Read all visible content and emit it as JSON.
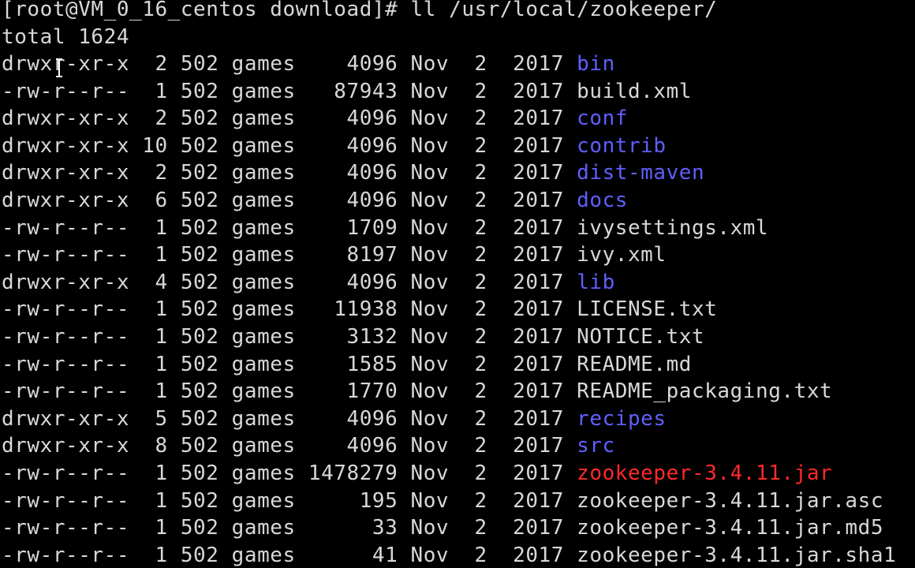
{
  "prompt": "[root@VM_0_16_centos download]# ll /usr/local/zookeeper/",
  "total": "total 1624",
  "entries": [
    {
      "perm": "drwxr-xr-x",
      "links": "2",
      "owner": "502",
      "group": "games",
      "size": "4096",
      "month": "Nov",
      "day": "2",
      "year": "2017",
      "name": "bin",
      "type": "dir"
    },
    {
      "perm": "-rw-r--r--",
      "links": "1",
      "owner": "502",
      "group": "games",
      "size": "87943",
      "month": "Nov",
      "day": "2",
      "year": "2017",
      "name": "build.xml",
      "type": "file"
    },
    {
      "perm": "drwxr-xr-x",
      "links": "2",
      "owner": "502",
      "group": "games",
      "size": "4096",
      "month": "Nov",
      "day": "2",
      "year": "2017",
      "name": "conf",
      "type": "dir"
    },
    {
      "perm": "drwxr-xr-x",
      "links": "10",
      "owner": "502",
      "group": "games",
      "size": "4096",
      "month": "Nov",
      "day": "2",
      "year": "2017",
      "name": "contrib",
      "type": "dir"
    },
    {
      "perm": "drwxr-xr-x",
      "links": "2",
      "owner": "502",
      "group": "games",
      "size": "4096",
      "month": "Nov",
      "day": "2",
      "year": "2017",
      "name": "dist-maven",
      "type": "dir"
    },
    {
      "perm": "drwxr-xr-x",
      "links": "6",
      "owner": "502",
      "group": "games",
      "size": "4096",
      "month": "Nov",
      "day": "2",
      "year": "2017",
      "name": "docs",
      "type": "dir"
    },
    {
      "perm": "-rw-r--r--",
      "links": "1",
      "owner": "502",
      "group": "games",
      "size": "1709",
      "month": "Nov",
      "day": "2",
      "year": "2017",
      "name": "ivysettings.xml",
      "type": "file"
    },
    {
      "perm": "-rw-r--r--",
      "links": "1",
      "owner": "502",
      "group": "games",
      "size": "8197",
      "month": "Nov",
      "day": "2",
      "year": "2017",
      "name": "ivy.xml",
      "type": "file"
    },
    {
      "perm": "drwxr-xr-x",
      "links": "4",
      "owner": "502",
      "group": "games",
      "size": "4096",
      "month": "Nov",
      "day": "2",
      "year": "2017",
      "name": "lib",
      "type": "dir"
    },
    {
      "perm": "-rw-r--r--",
      "links": "1",
      "owner": "502",
      "group": "games",
      "size": "11938",
      "month": "Nov",
      "day": "2",
      "year": "2017",
      "name": "LICENSE.txt",
      "type": "file"
    },
    {
      "perm": "-rw-r--r--",
      "links": "1",
      "owner": "502",
      "group": "games",
      "size": "3132",
      "month": "Nov",
      "day": "2",
      "year": "2017",
      "name": "NOTICE.txt",
      "type": "file"
    },
    {
      "perm": "-rw-r--r--",
      "links": "1",
      "owner": "502",
      "group": "games",
      "size": "1585",
      "month": "Nov",
      "day": "2",
      "year": "2017",
      "name": "README.md",
      "type": "file"
    },
    {
      "perm": "-rw-r--r--",
      "links": "1",
      "owner": "502",
      "group": "games",
      "size": "1770",
      "month": "Nov",
      "day": "2",
      "year": "2017",
      "name": "README_packaging.txt",
      "type": "file"
    },
    {
      "perm": "drwxr-xr-x",
      "links": "5",
      "owner": "502",
      "group": "games",
      "size": "4096",
      "month": "Nov",
      "day": "2",
      "year": "2017",
      "name": "recipes",
      "type": "dir"
    },
    {
      "perm": "drwxr-xr-x",
      "links": "8",
      "owner": "502",
      "group": "games",
      "size": "4096",
      "month": "Nov",
      "day": "2",
      "year": "2017",
      "name": "src",
      "type": "dir"
    },
    {
      "perm": "-rw-r--r--",
      "links": "1",
      "owner": "502",
      "group": "games",
      "size": "1478279",
      "month": "Nov",
      "day": "2",
      "year": "2017",
      "name": "zookeeper-3.4.11.jar",
      "type": "jar"
    },
    {
      "perm": "-rw-r--r--",
      "links": "1",
      "owner": "502",
      "group": "games",
      "size": "195",
      "month": "Nov",
      "day": "2",
      "year": "2017",
      "name": "zookeeper-3.4.11.jar.asc",
      "type": "file"
    },
    {
      "perm": "-rw-r--r--",
      "links": "1",
      "owner": "502",
      "group": "games",
      "size": "33",
      "month": "Nov",
      "day": "2",
      "year": "2017",
      "name": "zookeeper-3.4.11.jar.md5",
      "type": "file"
    },
    {
      "perm": "-rw-r--r--",
      "links": "1",
      "owner": "502",
      "group": "games",
      "size": "41",
      "month": "Nov",
      "day": "2",
      "year": "2017",
      "name": "zookeeper-3.4.11.jar.sha1",
      "type": "file"
    }
  ],
  "colors": {
    "background": "#000000",
    "text": "#d8d8d8",
    "directory": "#5f5fff",
    "archive": "#ff2a2a"
  }
}
